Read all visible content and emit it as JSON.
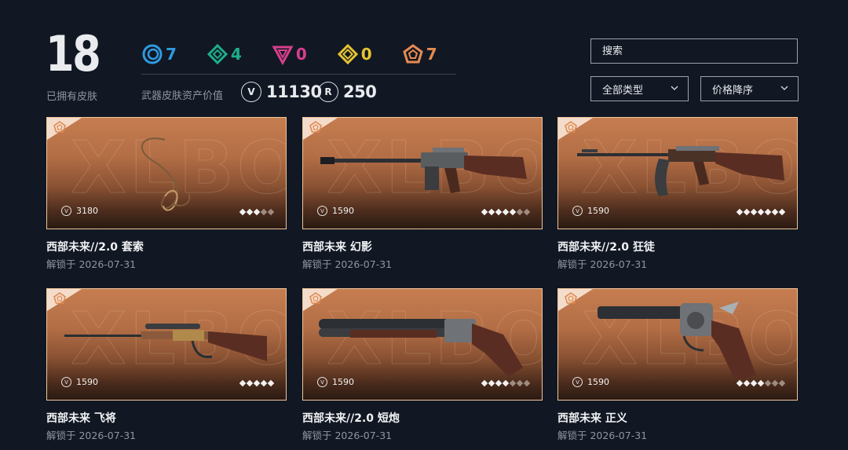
{
  "header": {
    "owned_count": "18",
    "owned_label": "已拥有皮肤",
    "value_label": "武器皮肤资产价值",
    "tiers": [
      {
        "name": "select-tier-icon",
        "count": "7",
        "color": "#2e9be0"
      },
      {
        "name": "deluxe-tier-icon",
        "count": "4",
        "color": "#1eae8c"
      },
      {
        "name": "premium-tier-icon",
        "count": "0",
        "color": "#d63f8c"
      },
      {
        "name": "exclusive-tier-icon",
        "count": "0",
        "color": "#e5c431"
      },
      {
        "name": "ultra-tier-icon",
        "count": "7",
        "color": "#e88a4f"
      }
    ],
    "vp_icon_glyph": "V",
    "vp_value": "11130",
    "rp_icon_glyph": "R",
    "rp_value": "250"
  },
  "controls": {
    "search_placeholder": "搜索",
    "type_filter": "全部类型",
    "sort_order": "价格降序"
  },
  "card_price_icon_glyph": "V",
  "skins": [
    {
      "name": "西部未来//2.0 套索",
      "unlock": "解锁于 2026-07-31",
      "price": "3180",
      "level": 3,
      "max_level": 5,
      "weapon": "lasso"
    },
    {
      "name": "西部未来 幻影",
      "unlock": "解锁于 2026-07-31",
      "price": "1590",
      "level": 5,
      "max_level": 7,
      "weapon": "rifle"
    },
    {
      "name": "西部未来//2.0 狂徒",
      "unlock": "解锁于 2026-07-31",
      "price": "1590",
      "level": 7,
      "max_level": 7,
      "weapon": "ak"
    },
    {
      "name": "西部未来 飞将",
      "unlock": "解锁于 2026-07-31",
      "price": "1590",
      "level": 5,
      "max_level": 5,
      "weapon": "sniper"
    },
    {
      "name": "西部未来//2.0 短炮",
      "unlock": "解锁于 2026-07-31",
      "price": "1590",
      "level": 4,
      "max_level": 7,
      "weapon": "shotgun"
    },
    {
      "name": "西部未来 正义",
      "unlock": "解锁于 2026-07-31",
      "price": "1590",
      "level": 4,
      "max_level": 7,
      "weapon": "revolver"
    }
  ]
}
